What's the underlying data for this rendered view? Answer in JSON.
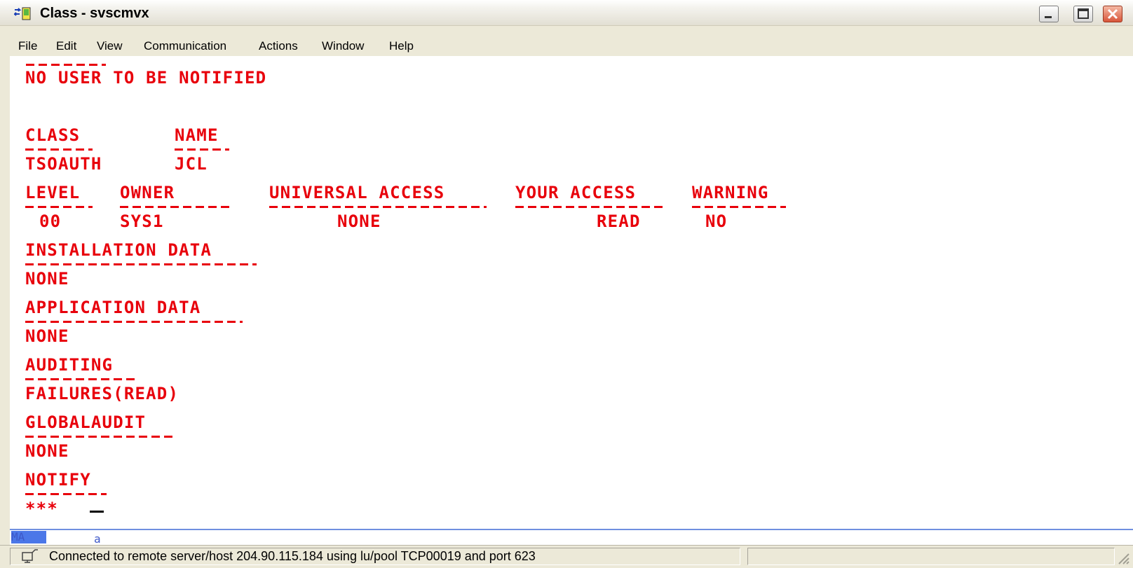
{
  "window": {
    "title": "Class - svscmvx"
  },
  "title_buttons": [
    "minimize",
    "maximize",
    "close"
  ],
  "menu": [
    "File",
    "Edit",
    "View",
    "Communication",
    "Actions",
    "Window",
    "Help"
  ],
  "terminal": {
    "color": "#e8000b",
    "notify_line": "NO USER TO BE NOTIFIED",
    "class_header": "CLASS",
    "name_header": "NAME",
    "class_value": "TSOAUTH",
    "name_value": "JCL",
    "level_header": "LEVEL",
    "owner_header": "OWNER",
    "uacc_header": "UNIVERSAL ACCESS",
    "your_access_header": "YOUR ACCESS",
    "warning_header": "WARNING",
    "level_value": "00",
    "owner_value": "SYS1",
    "uacc_value": "NONE",
    "your_access_value": "READ",
    "warning_value": "NO",
    "installation_data_header": "INSTALLATION DATA",
    "installation_data_value": "NONE",
    "application_data_header": "APPLICATION DATA",
    "application_data_value": "NONE",
    "auditing_header": "AUDITING",
    "auditing_value": "FAILURES(READ)",
    "globalaudit_header": "GLOBALAUDIT",
    "globalaudit_value": "NONE",
    "notify_header": "NOTIFY",
    "prompt": "***"
  },
  "oia": {
    "mode": "MA",
    "indicator": "a"
  },
  "status": {
    "message": "Connected to remote server/host 204.90.115.184 using lu/pool TCP00019 and port 623"
  }
}
